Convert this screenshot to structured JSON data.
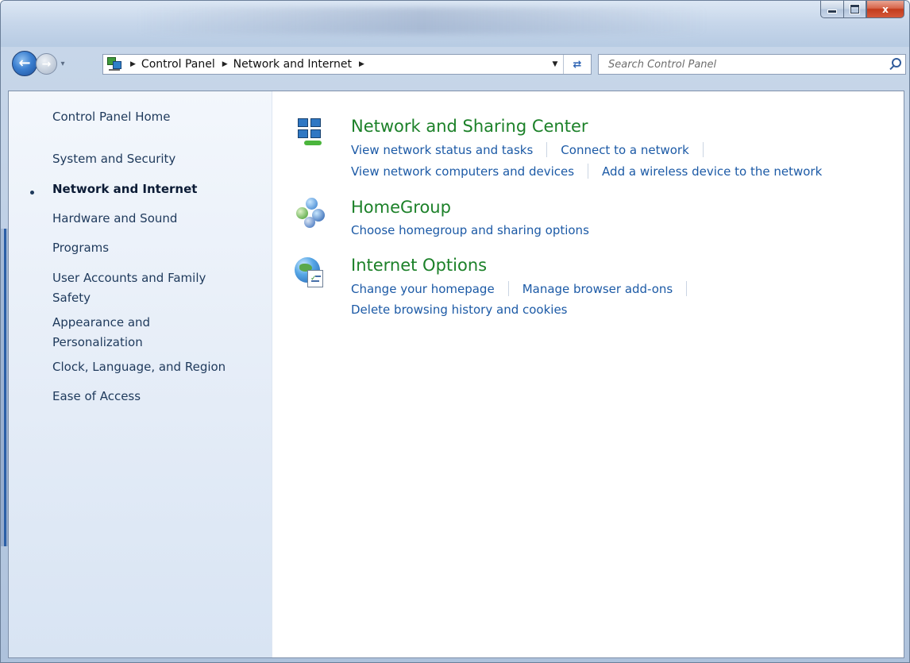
{
  "window": {
    "caption": {
      "minimize_glyph": "",
      "close_glyph": "x"
    }
  },
  "nav": {
    "back_icon": "back-arrow-icon",
    "forward_icon": "forward-arrow-icon",
    "breadcrumb": [
      "Control Panel",
      "Network and Internet"
    ],
    "search_placeholder": "Search Control Panel"
  },
  "sidebar": {
    "items": [
      {
        "label": "Control Panel Home",
        "current": false
      },
      {
        "label": "System and Security",
        "current": false
      },
      {
        "label": "Network and Internet",
        "current": true
      },
      {
        "label": "Hardware and Sound",
        "current": false
      },
      {
        "label": "Programs",
        "current": false
      },
      {
        "label": "User Accounts and Family Safety",
        "current": false
      },
      {
        "label": "Appearance and Personalization",
        "current": false
      },
      {
        "label": "Clock, Language, and Region",
        "current": false
      },
      {
        "label": "Ease of Access",
        "current": false
      }
    ],
    "user_accounts_line1": "User Accounts and Family",
    "user_accounts_line2": "Safety",
    "appearance_line1": "Appearance and",
    "appearance_line2": "Personalization"
  },
  "sections": [
    {
      "title": "Network and Sharing Center",
      "icon": "network-sharing-icon",
      "link_rows": [
        [
          "View network status and tasks",
          "Connect to a network"
        ],
        [
          "View network computers and devices",
          "Add a wireless device to the network"
        ]
      ]
    },
    {
      "title": "HomeGroup",
      "icon": "homegroup-icon",
      "link_rows": [
        [
          "Choose homegroup and sharing options"
        ]
      ]
    },
    {
      "title": "Internet Options",
      "icon": "internet-options-icon",
      "link_rows": [
        [
          "Change your homepage",
          "Manage browser add-ons"
        ],
        [
          "Delete browsing history and cookies"
        ]
      ]
    }
  ],
  "colors": {
    "section_title": "#1c8129",
    "link": "#1c5aa6",
    "sidebar_text": "#1e395b"
  }
}
